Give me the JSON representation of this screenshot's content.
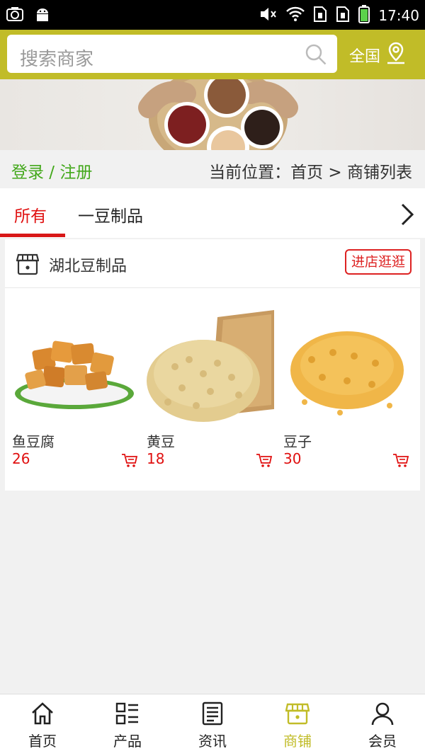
{
  "status_bar": {
    "time": "17:40",
    "icons": [
      "camera-icon",
      "android-icon",
      "mute-icon",
      "wifi-icon",
      "sim1-icon",
      "sim2-icon",
      "battery-icon"
    ]
  },
  "header": {
    "search_placeholder": "搜索商家",
    "region_label": "全国"
  },
  "breadcrumb": {
    "login_label": "登录 / 注册",
    "location_text": "当前位置：首页 > 商铺列表"
  },
  "tabs": [
    {
      "label": "所有",
      "active": true
    },
    {
      "label": "一豆制品",
      "active": false
    }
  ],
  "shop": {
    "name": "湖北豆制品",
    "visit_label": "进店逛逛",
    "products": [
      {
        "name": "鱼豆腐",
        "price": "26"
      },
      {
        "name": "黄豆",
        "price": "18"
      },
      {
        "name": "豆子",
        "price": "30"
      }
    ]
  },
  "bottom_nav": [
    {
      "label": "首页",
      "icon": "home-icon",
      "active": false
    },
    {
      "label": "产品",
      "icon": "grid-list-icon",
      "active": false
    },
    {
      "label": "资讯",
      "icon": "news-icon",
      "active": false
    },
    {
      "label": "商铺",
      "icon": "store-icon",
      "active": true
    },
    {
      "label": "会员",
      "icon": "user-icon",
      "active": false
    }
  ],
  "colors": {
    "header_bg": "#c1bc28",
    "accent_red": "#e01010",
    "login_green": "#43a81b"
  }
}
